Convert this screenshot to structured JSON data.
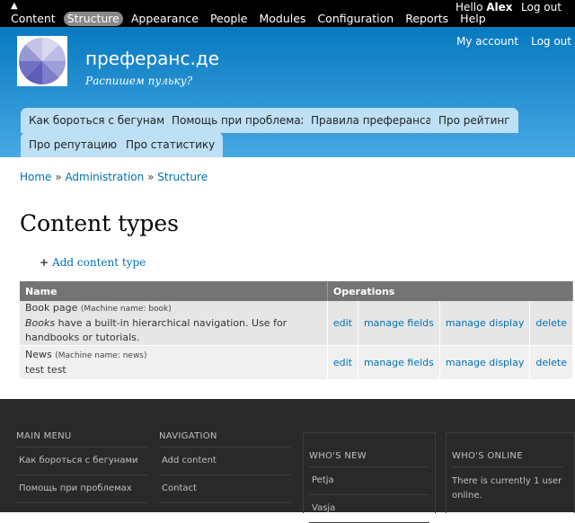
{
  "toolbar": {
    "home_icon": "home-icon",
    "items": [
      "Content",
      "Structure",
      "Appearance",
      "People",
      "Modules",
      "Configuration",
      "Reports",
      "Help"
    ],
    "active": "Structure",
    "hello_prefix": "Hello",
    "user": "Alex",
    "logout": "Log out"
  },
  "header": {
    "site_name": "преферанс.де",
    "slogan": "Распишем пульку?",
    "secondary": [
      "My account",
      "Log out"
    ],
    "tabs": [
      "Как бороться с бегунами",
      "Помощь при проблемах",
      "Правила преферанса",
      "Про рейтинг",
      "Про репутацию",
      "Про статистику"
    ]
  },
  "breadcrumb": [
    "Home",
    "Administration",
    "Structure"
  ],
  "page": {
    "title": "Content types",
    "add_link": "Add content type"
  },
  "table": {
    "headers": [
      "Name",
      "Operations"
    ],
    "rows": [
      {
        "name": "Book page",
        "machine": "(Machine name: book)",
        "desc_em": "Books",
        "desc_rest": " have a built-in hierarchical navigation. Use for handbooks or tutorials.",
        "ops": [
          "edit",
          "manage fields",
          "manage display",
          "delete"
        ]
      },
      {
        "name": "News",
        "machine": "(Machine name: news)",
        "desc_em": "",
        "desc_rest": "test test",
        "ops": [
          "edit",
          "manage fields",
          "manage display",
          "delete"
        ]
      }
    ]
  },
  "footer": {
    "main_menu": {
      "title": "MAIN MENU",
      "items": [
        "Как бороться с бегунами",
        "Помощь при проблемах"
      ]
    },
    "navigation": {
      "title": "NAVIGATION",
      "items": [
        "Add content",
        "Contact"
      ]
    },
    "whos_new": {
      "title": "WHO'S NEW",
      "items": [
        "Petja",
        "Vasja"
      ]
    },
    "whos_online": {
      "title": "WHO'S ONLINE",
      "text": "There is currently 1 user online."
    }
  }
}
